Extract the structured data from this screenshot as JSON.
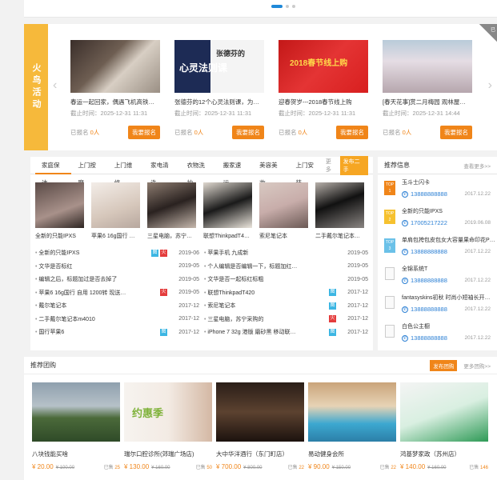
{
  "fire": {
    "label": "火鸟活动",
    "ribbon": "已",
    "activities": [
      {
        "title": "春运一起回家，偶遇飞机高铁…",
        "deadline": "截止时间：2025-12-31 11:31",
        "signed_prefix": "已报名",
        "signed_count": "0人",
        "button": "我要报名"
      },
      {
        "title": "张德芬的12个心灵法则课，为…",
        "deadline": "截止时间：2025-12-31 11:31",
        "signed_prefix": "已报名",
        "signed_count": "0人",
        "button": "我要报名",
        "image_text_1": "张德芬的",
        "image_text_2": "心灵法则课"
      },
      {
        "title": "迎春贺岁---2018春节线上购",
        "deadline": "截止时间：2025-12-31 11:31",
        "signed_prefix": "已报名",
        "signed_count": "0人",
        "button": "我要报名",
        "image_text_1": "2018春节线上购"
      },
      {
        "title": "[春天花事]赏二月梅园 观林屋…",
        "deadline": "截止时间：2025-12-31 14:44",
        "signed_prefix": "已报名",
        "signed_count": "0人",
        "button": "我要报名"
      }
    ]
  },
  "classified": {
    "tabs": [
      "家庭保洁",
      "上门按摩",
      "上门维修",
      "家电清洗",
      "衣物洗护",
      "搬家速运",
      "美容美妆",
      "上门安装"
    ],
    "more": "更多",
    "post": "发布二手",
    "thumbs": [
      "全新的只能IPXS",
      "苹果6 16g国行 自…",
      "三星电脑，苏宁采…",
      "联想ThinkpadT4…",
      "索尼笔记本",
      "二手戴尔笔记本…"
    ],
    "left_rows": [
      {
        "text": "全新的只能IPXS",
        "badges": [
          "图",
          "火"
        ],
        "date": "2019-06"
      },
      {
        "text": "文华是否标红",
        "badges": [],
        "date": "2019-05"
      },
      {
        "text": "编辑之后，标题加过是否去掉了",
        "badges": [],
        "date": "2019-05"
      },
      {
        "text": "苹果6 16g国行 自用 1200转 现送…",
        "badges": [
          "火"
        ],
        "date": "2019-05"
      },
      {
        "text": "戴尔笔记本",
        "badges": [],
        "date": "2017-12"
      },
      {
        "text": "二手戴尔笔记本m4010",
        "badges": [],
        "date": "2017-12"
      },
      {
        "text": "国行苹果6",
        "badges": [
          "图"
        ],
        "date": "2017-12"
      }
    ],
    "right_rows": [
      {
        "text": "苹果手机 九成新",
        "badges": [],
        "date": "2019-05"
      },
      {
        "text": "个人编辑是否编辑一下，标题加红…",
        "badges": [],
        "date": "2019-05"
      },
      {
        "text": "文华是否一起标红标粗",
        "badges": [],
        "date": "2019-05"
      },
      {
        "text": "联想ThinkpadT420",
        "badges": [
          "图"
        ],
        "date": "2017-12"
      },
      {
        "text": "索尼笔记本",
        "badges": [
          "图"
        ],
        "date": "2017-12"
      },
      {
        "text": "三星电脑，苏宁采购的",
        "badges": [
          "火"
        ],
        "date": "2017-12"
      },
      {
        "text": "iPhone 7 32g 港版 磨砂黑 移动联…",
        "badges": [
          "图"
        ],
        "date": "2017-12"
      }
    ]
  },
  "recommend": {
    "title": "推荐信息",
    "more": "查看更多>>",
    "items": [
      {
        "badge": "TOP 1",
        "name": "玉斗士闪卡",
        "phone": "13888888888",
        "date": "2017.12.22"
      },
      {
        "badge": "TOP 2",
        "name": "全新的只能IPXS",
        "phone": "17005217222",
        "date": "2019.06.08"
      },
      {
        "badge": "TOP 3",
        "name": "单肩包挎包皮包女大容量果命印花P…",
        "phone": "13888888888",
        "date": "2017.12.22"
      },
      {
        "badge": "",
        "name": "全锦系统T",
        "phone": "13888888888",
        "date": "2017.12.22"
      },
      {
        "badge": "",
        "name": "fantasyskins初秋 时尚小短袖长开…",
        "phone": "13888888888",
        "date": "2017.12.22"
      },
      {
        "badge": "",
        "name": "白色公主橱",
        "phone": "13888888888",
        "date": "2017.12.22"
      }
    ]
  },
  "group": {
    "title": "推荐团购",
    "post": "发布团购",
    "more": "更多团购>>",
    "deals": [
      {
        "name": "八块钱能买啥",
        "price": "¥ 20.00",
        "old": "¥ 100.00",
        "sold_prefix": "已售",
        "sold": "25"
      },
      {
        "name": "瑞尔口腔诊所(郊瑞广场店)",
        "price": "¥ 130.00",
        "old": "¥ 160.00",
        "sold_prefix": "已售",
        "sold": "50",
        "image_text": "约惠季"
      },
      {
        "name": "大中华洋酒行（东门町店）",
        "price": "¥ 700.00",
        "old": "¥ 800.00",
        "sold_prefix": "已售",
        "sold": "22"
      },
      {
        "name": "易动健身会所",
        "price": "¥ 90.00",
        "old": "¥ 150.00",
        "sold_prefix": "已售",
        "sold": "22"
      },
      {
        "name": "鸿基梦家政（苏州店）",
        "price": "¥ 140.00",
        "old": "¥ 160.00",
        "sold_prefix": "已售",
        "sold": "146"
      }
    ]
  }
}
